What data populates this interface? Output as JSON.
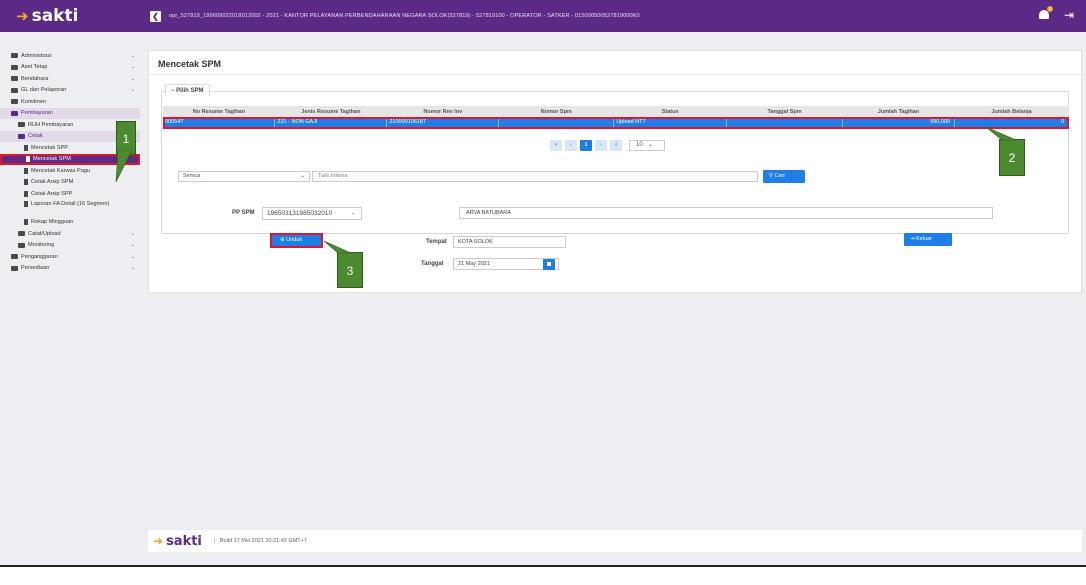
{
  "app": {
    "brand": "sakti",
    "session": "opr_527819_199609022018012002 - 2021 - KANTOR PELAYANAN PERBENDAHARAAN NEGARA SOLOK(527819) - 527819100 - OPERATOR - SATKER - 015000500527819000K0",
    "notification_count": "3"
  },
  "sidebar": {
    "items": [
      {
        "label": "Administrasi"
      },
      {
        "label": "Aset Tetap"
      },
      {
        "label": "Bendahara"
      },
      {
        "label": "GL dan Pelaporan"
      },
      {
        "label": "Komitmen"
      },
      {
        "label": "Pembayaran"
      },
      {
        "label": "RUH Pembayaran"
      },
      {
        "label": "Cetak"
      },
      {
        "label": "Mencetak SPP"
      },
      {
        "label": "Mencetak SPM"
      },
      {
        "label": "Mencetak Karwas Pagu"
      },
      {
        "label": "Cetak Arsip SPM"
      },
      {
        "label": "Cetak Arsip SPP"
      },
      {
        "label": "Laporan FA Detail (16 Segmen)"
      },
      {
        "label": "Rekap Mingguan"
      },
      {
        "label": "Catat/Upload"
      },
      {
        "label": "Monitoring"
      },
      {
        "label": "Penganggaran"
      },
      {
        "label": "Persediaan"
      }
    ]
  },
  "page": {
    "title": "Mencetak SPM",
    "legend": "− Pilih SPM",
    "table": {
      "headers": [
        "No Resume Tagihan",
        "Jenis Resume Tagihan",
        "Nomor Rev Inv",
        "Nomor Spm",
        "Status",
        "Tanggal Spm",
        "Jumlah Tagihan",
        "Jumlah Belanja"
      ],
      "rows": [
        [
          "00054T",
          "231 - NON GAJI",
          "210000106187",
          "",
          "Upload NTT",
          "",
          "990,000",
          "0"
        ]
      ]
    },
    "pager": {
      "first": "«",
      "prev": "‹",
      "current": "1",
      "next": "›",
      "last": "»",
      "page_size": "10"
    },
    "filter": {
      "select_value": "Semua",
      "input_placeholder": "Tulis kriteria",
      "search_label": "Cari"
    },
    "ppspm_label": "PP SPM",
    "ppspm_value": "196503131985032010",
    "ppspm_name": "ARVA BATUBARA",
    "unduh_label": "Unduh",
    "tempat_label": "Tempat",
    "tempat_value": "KOTA SOLOK",
    "tanggal_label": "Tanggal",
    "tanggal_value": "21 May 2021",
    "keluar_label": "Keluar"
  },
  "callouts": [
    "1",
    "2",
    "3"
  ],
  "footer": {
    "logo": "sakti",
    "build": "Build 17 Mei 2021 20:21:42 GMT+7"
  },
  "colors": {
    "brand": "#5b2a86",
    "accent": "#1e7ee8",
    "highlight": "#e0162b",
    "callout": "#4b8a2f"
  }
}
